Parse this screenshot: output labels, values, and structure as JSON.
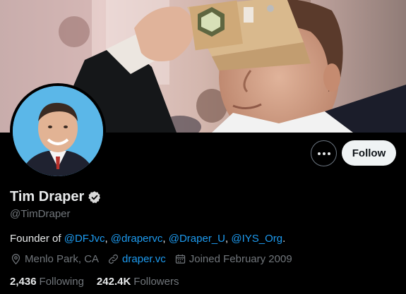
{
  "profile": {
    "name": "Tim Draper",
    "handle": "@TimDraper",
    "verified": true,
    "bio_prefix": "Founder of ",
    "bio_links": [
      "@DFJvc",
      "@drapervc",
      "@Draper_U",
      "@IYS_Org"
    ],
    "bio_sep": ", ",
    "bio_suffix": ".",
    "location": "Menlo Park, CA",
    "website": "draper.vc",
    "joined": "Joined February 2009"
  },
  "stats": {
    "following_count": "2,436",
    "following_label": "Following",
    "followers_count": "242.4K",
    "followers_label": "Followers"
  },
  "actions": {
    "follow_label": "Follow",
    "more_icon": "more-horizontal-icon"
  },
  "icons": {
    "location": "location-pin-icon",
    "website": "link-icon",
    "joined": "calendar-icon",
    "verified": "verified-badge-icon"
  },
  "colors": {
    "background": "#000000",
    "link": "#1d9bf0",
    "secondary_text": "#71767b",
    "primary_text": "#e7e9ea",
    "follow_bg": "#eff3f4"
  }
}
